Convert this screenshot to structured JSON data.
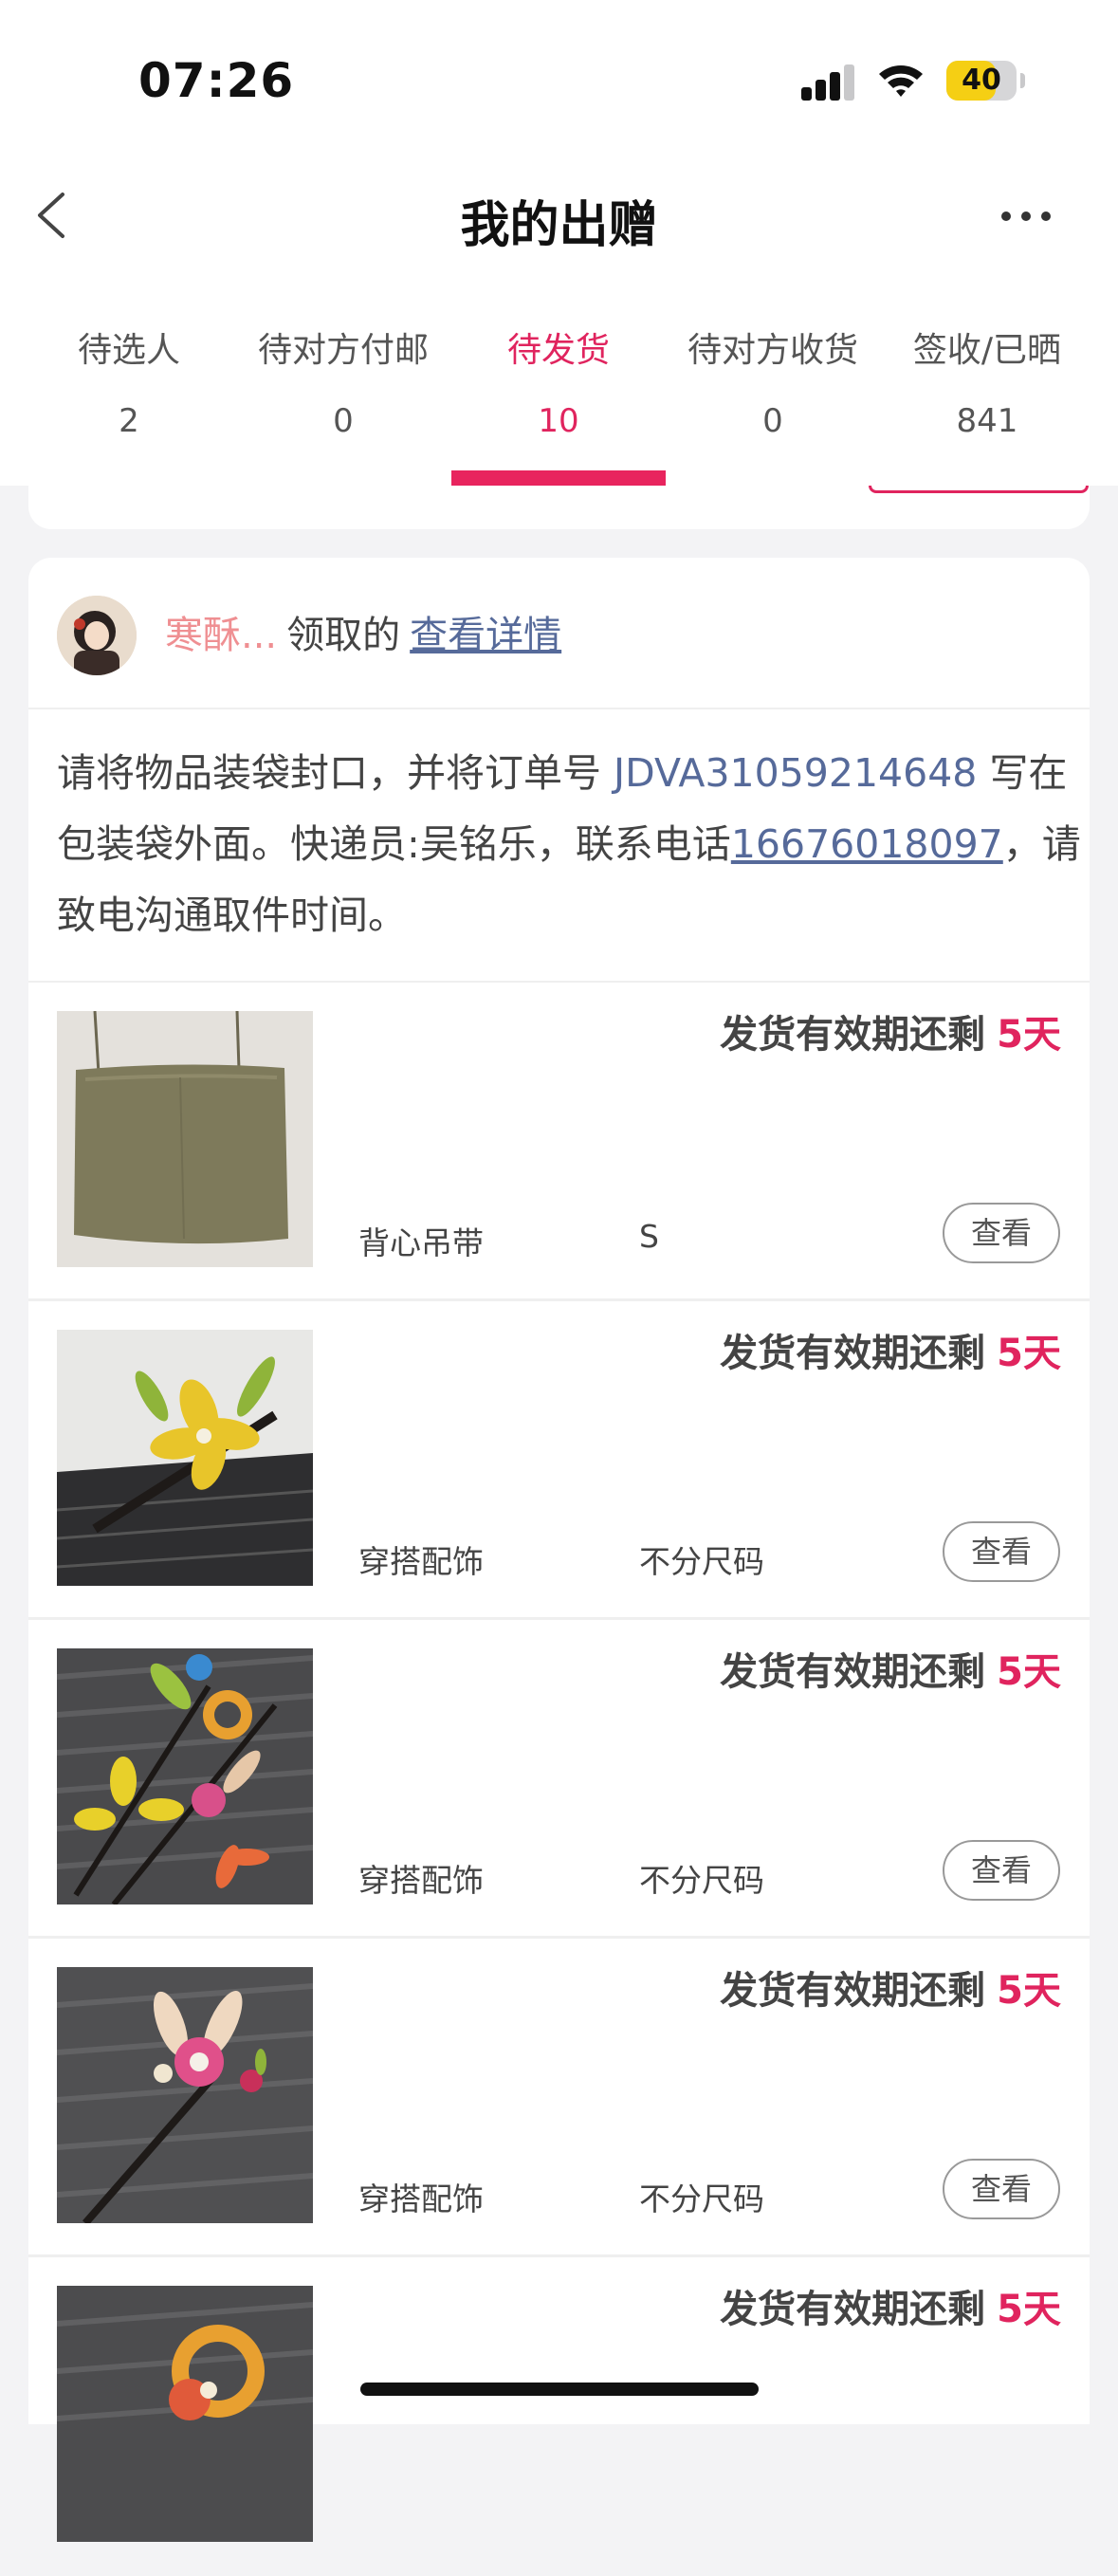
{
  "status_bar": {
    "time": "07:26",
    "battery": "40"
  },
  "header": {
    "title": "我的出赠"
  },
  "tabs": [
    {
      "label": "待选人",
      "count": "2"
    },
    {
      "label": "待对方付邮",
      "count": "0"
    },
    {
      "label": "待发货",
      "count": "10"
    },
    {
      "label": "待对方收货",
      "count": "0"
    },
    {
      "label": "签收/已晒",
      "count": "841"
    }
  ],
  "active_tab": "待发货",
  "order": {
    "recipient": "寒酥...",
    "claimed_text": "领取的",
    "details_link": "查看详情",
    "notice": {
      "part1": "请将物品装袋封口，并将订单号 ",
      "order_no": "JDVA31059214648",
      "part2": " 写在包装袋外面。快递员:吴铭乐，联系电话",
      "phone": "16676018097",
      "part3": "，请致电沟通取件时间。"
    }
  },
  "items": [
    {
      "deadline_label": "发货有效期还剩",
      "days": "5天",
      "category": "背心吊带",
      "size": "S",
      "view": "查看"
    },
    {
      "deadline_label": "发货有效期还剩",
      "days": "5天",
      "category": "穿搭配饰",
      "size": "不分尺码",
      "view": "查看"
    },
    {
      "deadline_label": "发货有效期还剩",
      "days": "5天",
      "category": "穿搭配饰",
      "size": "不分尺码",
      "view": "查看"
    },
    {
      "deadline_label": "发货有效期还剩",
      "days": "5天",
      "category": "穿搭配饰",
      "size": "不分尺码",
      "view": "查看"
    },
    {
      "deadline_label": "发货有效期还剩",
      "days": "5天"
    }
  ],
  "colors": {
    "accent": "#e0245e",
    "link": "#566a9a",
    "recipient": "#ef8f92"
  }
}
